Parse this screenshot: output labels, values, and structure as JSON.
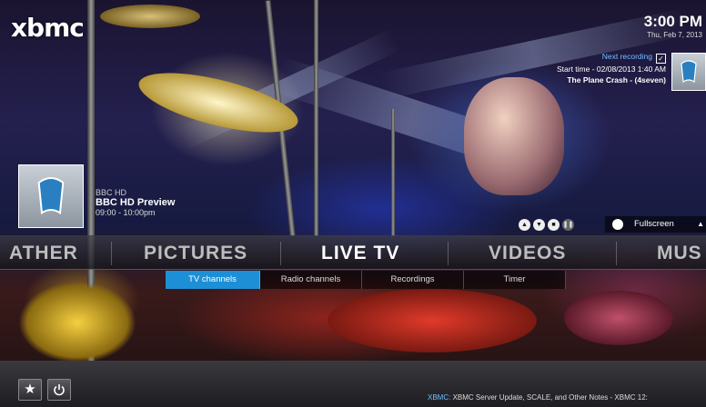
{
  "app": {
    "logo": "xbmc"
  },
  "clock": {
    "time": "3:00 PM",
    "date": "Thu, Feb 7, 2013"
  },
  "next_recording": {
    "label": "Next recording",
    "start": "Start time - 02/08/2013 1:40 AM",
    "title": "The Plane Crash - (4seven)"
  },
  "now_playing": {
    "channel": "BBC HD",
    "show": "BBC HD Preview",
    "time": "09:00 - 10:00pm"
  },
  "osd": {
    "buttons": [
      "up-icon",
      "down-icon",
      "stop-icon",
      "pause-icon",
      "record-icon"
    ],
    "fullscreen_label": "Fullscreen"
  },
  "main_menu": {
    "items": [
      {
        "label": "ATHER",
        "icon": "weather"
      },
      {
        "label": "PICTURES",
        "icon": "pictures"
      },
      {
        "label": "LIVE TV",
        "icon": "live-tv",
        "active": true
      },
      {
        "label": "VIDEOS",
        "icon": "videos"
      },
      {
        "label": "MUS",
        "icon": "music"
      }
    ]
  },
  "sub_menu": {
    "items": [
      {
        "label": "TV channels",
        "active": true
      },
      {
        "label": "Radio channels"
      },
      {
        "label": "Recordings"
      },
      {
        "label": "Timer"
      }
    ]
  },
  "bottom_bar": {
    "favourites_icon": "star-icon",
    "power_icon": "power-icon",
    "ticker_source": "XBMC:",
    "ticker_text": " XBMC Server Update, SCALE, and Other Notes - XBMC 12:"
  },
  "colors": {
    "accent": "#1d8fd6",
    "ticker_source": "#6fc0ff"
  }
}
